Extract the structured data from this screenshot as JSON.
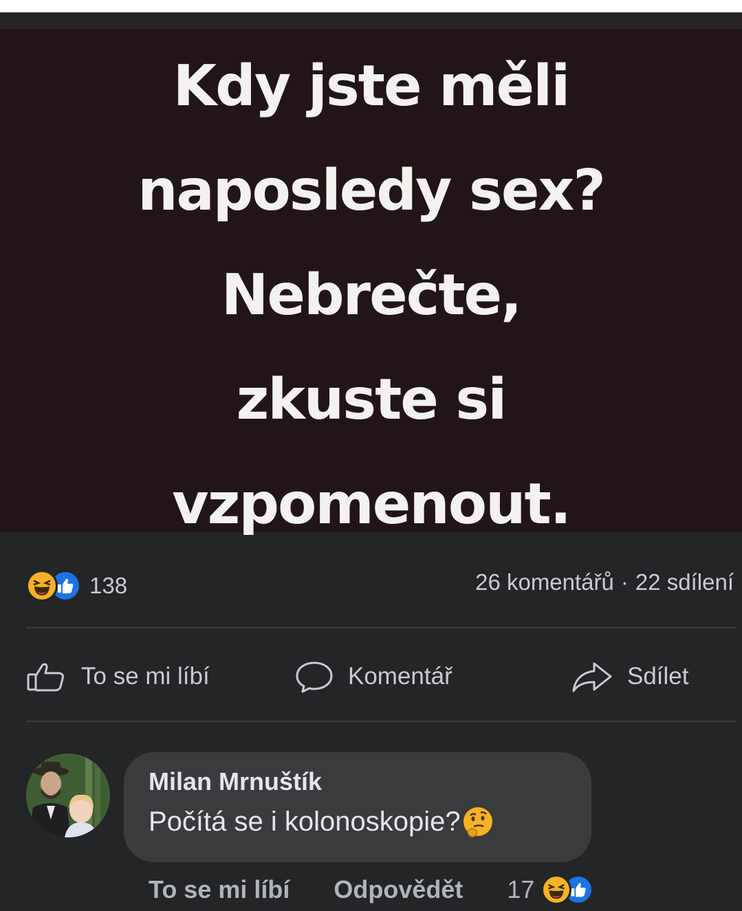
{
  "post": {
    "image_text_lines": [
      "Kdy jste měli",
      "naposledy sex?",
      "Nebrečte,",
      "zkuste si",
      "vzpomenout."
    ],
    "reactions": {
      "icons": [
        "haha-icon",
        "like-icon"
      ],
      "count": "138"
    },
    "comments_count": "26 komentářů",
    "separator": "·",
    "shares_count": "22 sdílení"
  },
  "actions": {
    "like_label": "To se mi líbí",
    "comment_label": "Komentář",
    "share_label": "Sdílet"
  },
  "comment": {
    "author": "Milan Mrnuštík",
    "text": "Počítá se i kolonoskopie?",
    "emoji": "thinking-face-icon",
    "like_label": "To se mi líbí",
    "reply_label": "Odpovědět",
    "reactions_count": "17",
    "reaction_icons": [
      "haha-icon",
      "like-icon"
    ]
  },
  "colors": {
    "background": "#242526",
    "image_background": "#221517",
    "text_primary": "#e4e6eb",
    "text_secondary": "#b0b3b8",
    "like_blue": "#1b74e4",
    "haha_yellow": "#f7b125"
  }
}
